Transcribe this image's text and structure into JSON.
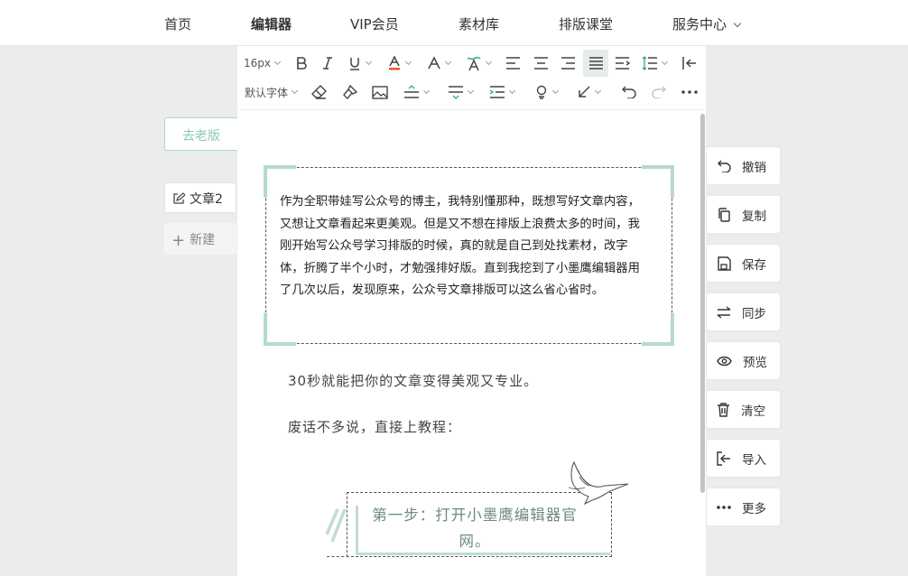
{
  "nav": {
    "items": [
      "首页",
      "编辑器",
      "VIP会员",
      "素材库",
      "排版课堂",
      "服务中心"
    ],
    "active_index": 1
  },
  "sidebar": {
    "old_version_button": "去老版",
    "current_doc": "文章2",
    "new_doc": "新建"
  },
  "toolbar": {
    "font_size": "16px",
    "font_family": "默认字体"
  },
  "content": {
    "framed_paragraph": "作为全职带娃写公众号的博主，我特别懂那种，既想写好文章内容，又想让文章看起来更美观。但是又不想在排版上浪费太多的时间，我刚开始写公众号学习排版的时候，真的就是自己到处找素材，改字体，折腾了半个小时，才勉强排好版。直到我挖到了小墨鹰编辑器用了几次以后，发现原来，公众号文章排版可以这么省心省时。",
    "line1": "30秒就能把你的文章变得美观又专业。",
    "line2": "废话不多说，直接上教程：",
    "step_title": "第一步：打开小墨鹰编辑器官网。"
  },
  "actions": [
    "撤销",
    "复制",
    "保存",
    "同步",
    "预览",
    "清空",
    "导入",
    "更多"
  ],
  "colors": {
    "accent_green": "#b7d9cc",
    "step_text": "#6f8a7e",
    "font_color_underline": "#e8572f"
  }
}
